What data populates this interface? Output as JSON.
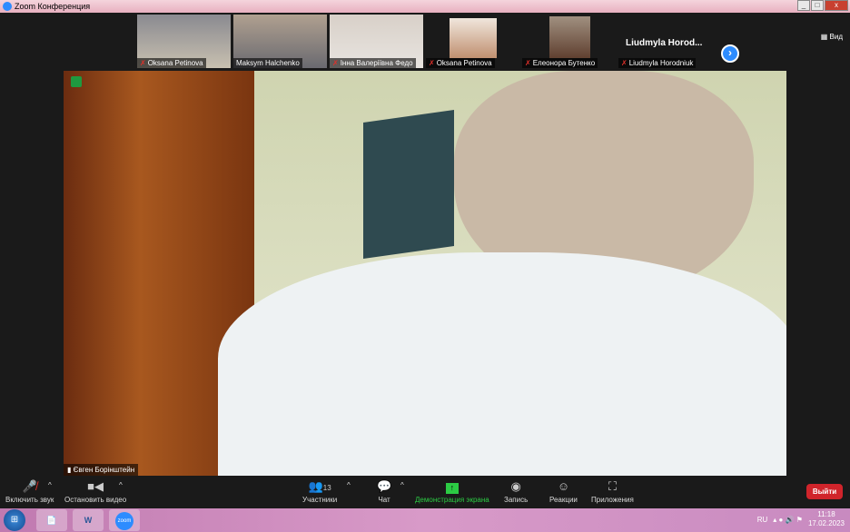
{
  "window": {
    "title": "Zoom Конференция"
  },
  "participants": [
    {
      "name": "Oksana Petinova",
      "muted": true
    },
    {
      "name": "Maksym Halchenko",
      "muted": false
    },
    {
      "name": "Інна Валеріївна Федо",
      "muted": true
    },
    {
      "name": "Oksana Petinova",
      "muted": true
    },
    {
      "name": "Елеонора Бутенко",
      "muted": true
    },
    {
      "name": "Liudmyla Horodniuk",
      "muted": true,
      "display_title": "Liudmyla  Horod..."
    }
  ],
  "view_label": "Вид",
  "speaker": {
    "name": "Євген Борінштейн"
  },
  "toolbar": {
    "unmute": "Включить звук",
    "stop_video": "Остановить видео",
    "participants": "Участники",
    "participants_count": "13",
    "chat": "Чат",
    "share": "Демонстрация экрана",
    "record": "Запись",
    "reactions": "Реакции",
    "apps": "Приложения",
    "leave": "Выйти"
  },
  "taskbar": {
    "lang": "RU",
    "time": "11:18",
    "date": "17.02.2023",
    "zoom_label": "zoom",
    "word_label": "W"
  }
}
